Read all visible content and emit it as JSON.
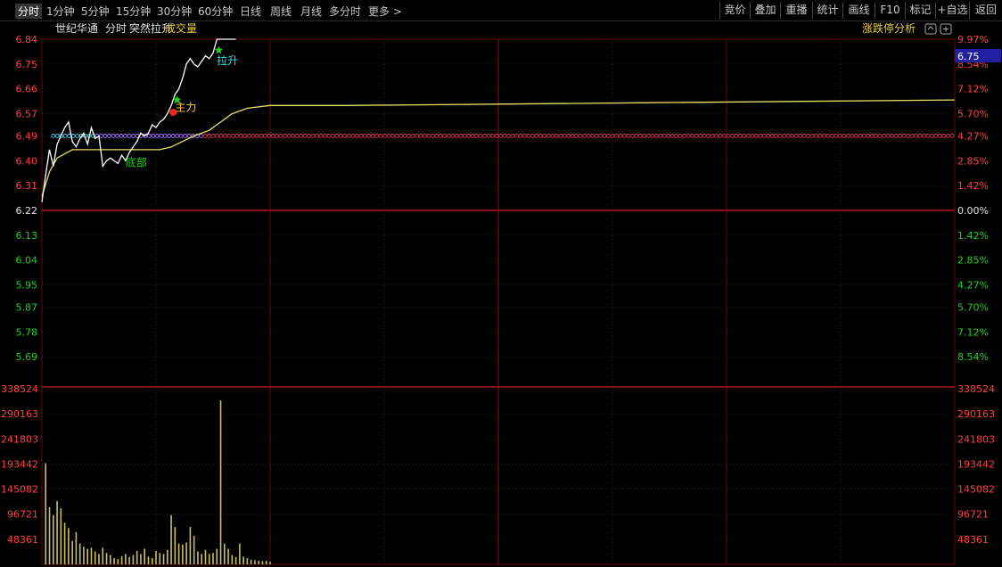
{
  "toolbar": {
    "left": [
      "分时",
      "1分钟",
      "5分钟",
      "15分钟",
      "30分钟",
      "60分钟",
      "日线",
      "周线",
      "月线",
      "多分时",
      "更多 >"
    ],
    "right": [
      "竞价",
      "叠加",
      "重播",
      "统计",
      "画线",
      "F10",
      "标记",
      "+自选",
      "返回"
    ]
  },
  "header": {
    "stock_name": "世纪华通",
    "labels": [
      "分时",
      "突然拉升"
    ],
    "indicator": "成交量",
    "right_label": "涨跌停分析",
    "current_price_tag": "6.75"
  },
  "colors": {
    "up": "#ff4040",
    "down": "#20d020",
    "neutral": "#e0e0e0",
    "price_line": "#ffffff",
    "avg_line": "#e8e060",
    "grid": "#6a0a0a",
    "volume": "#c8c060",
    "price_tag_bg": "#2020a0",
    "signal_text": "#30e0e0"
  },
  "chart_data": {
    "type": "line",
    "prev_close": 6.22,
    "price_axis": {
      "ylim": [
        5.6,
        6.84
      ],
      "ticks": [
        6.84,
        6.75,
        6.66,
        6.57,
        6.49,
        6.4,
        6.31,
        6.22,
        6.13,
        6.04,
        5.95,
        5.87,
        5.78,
        5.69
      ],
      "tick_labels": [
        "6.84",
        "6.75",
        "6.66",
        "6.57",
        "6.49",
        "6.40",
        "6.31",
        "6.22",
        "6.13",
        "6.04",
        "5.95",
        "5.87",
        "5.78",
        "5.69"
      ],
      "pct_labels": [
        "9.97%",
        "8.54%",
        "7.12%",
        "5.70%",
        "4.27%",
        "2.85%",
        "1.42%",
        "0.00%",
        "1.42%",
        "2.85%",
        "4.27%",
        "5.70%",
        "7.12%",
        "8.54%"
      ]
    },
    "volume_axis": {
      "ylim": [
        0,
        338524
      ],
      "ticks": [
        338524,
        290163,
        241803,
        193442,
        145082,
        96721,
        48361
      ],
      "tick_labels": [
        "338524",
        "290163",
        "241803",
        "193442",
        "145082",
        "96721",
        "48361"
      ]
    },
    "minutes_total": 240,
    "series": [
      {
        "key": "price",
        "x": [
          0,
          1,
          2,
          3,
          4,
          5,
          6,
          7,
          8,
          9,
          10,
          11,
          12,
          13,
          14,
          15,
          16,
          17,
          18,
          19,
          20,
          21,
          22,
          23,
          24,
          25,
          26,
          27,
          28,
          29,
          30,
          31,
          32,
          33,
          34,
          35,
          36,
          37,
          38,
          39,
          40,
          41,
          42,
          43,
          44,
          45,
          46,
          47,
          48,
          49,
          50,
          51
        ],
        "values": [
          6.25,
          6.35,
          6.44,
          6.38,
          6.46,
          6.49,
          6.52,
          6.54,
          6.47,
          6.45,
          6.48,
          6.5,
          6.46,
          6.52,
          6.48,
          6.49,
          6.38,
          6.4,
          6.41,
          6.4,
          6.39,
          6.42,
          6.4,
          6.43,
          6.45,
          6.47,
          6.5,
          6.49,
          6.5,
          6.53,
          6.52,
          6.54,
          6.55,
          6.57,
          6.6,
          6.64,
          6.66,
          6.7,
          6.75,
          6.77,
          6.75,
          6.74,
          6.76,
          6.78,
          6.77,
          6.79,
          6.84,
          6.84,
          6.84,
          6.84,
          6.84,
          6.84
        ]
      },
      {
        "key": "avg",
        "x": [
          0,
          2,
          4,
          8,
          12,
          16,
          20,
          24,
          28,
          31,
          34,
          37,
          40,
          44,
          47,
          50,
          54,
          60,
          80,
          120,
          160,
          200,
          240
        ],
        "values": [
          6.27,
          6.36,
          6.41,
          6.44,
          6.44,
          6.44,
          6.44,
          6.44,
          6.44,
          6.44,
          6.45,
          6.47,
          6.49,
          6.51,
          6.54,
          6.57,
          6.59,
          6.6,
          6.6,
          6.605,
          6.61,
          6.615,
          6.62
        ]
      }
    ],
    "volume": [
      195000,
      110000,
      95000,
      122000,
      108000,
      80000,
      70000,
      45000,
      62000,
      40000,
      34000,
      30000,
      32000,
      25000,
      20000,
      32000,
      22000,
      18000,
      12000,
      10000,
      16000,
      20000,
      14000,
      18000,
      26000,
      20000,
      30000,
      15000,
      12000,
      26000,
      22000,
      20000,
      28000,
      95000,
      72000,
      40000,
      38000,
      42000,
      72000,
      55000,
      25000,
      20000,
      28000,
      20000,
      22000,
      30000,
      316000,
      40000,
      30000,
      18000,
      14000,
      40000,
      15000,
      12000,
      9000,
      8000,
      7000,
      6000,
      7000,
      5000
    ],
    "annotations": [
      {
        "text": "底部",
        "x": 22,
        "y": 6.38,
        "color": "#20d020"
      },
      {
        "text": "主力",
        "x": 35,
        "y": 6.58,
        "color": "#ffd040"
      },
      {
        "text": "拉升",
        "x": 46,
        "y": 6.75,
        "color": "#30e0e0"
      }
    ],
    "signal_dots": {
      "price": 6.49,
      "from_minute": 3,
      "to_minute": 240
    }
  }
}
